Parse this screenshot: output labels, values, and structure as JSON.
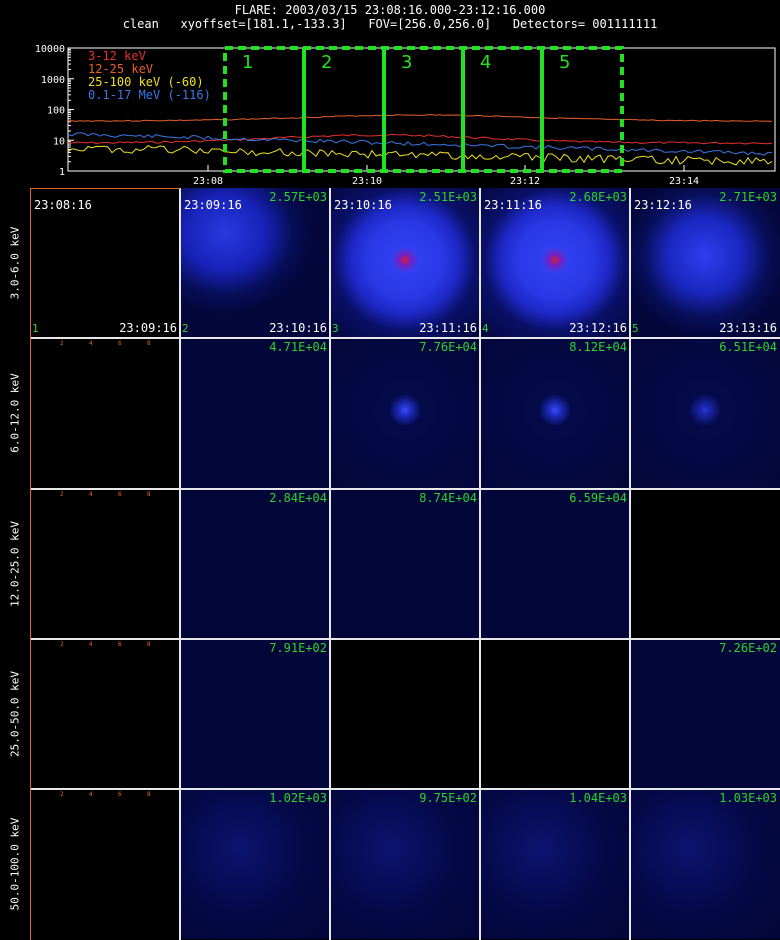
{
  "header": {
    "line1": "FLARE: 2003/03/15 23:08:16.000-23:12:16.000",
    "line2": "clean   xyoffset=[181.1,-133.3]   FOV=[256.0,256.0]   Detectors= 001111111"
  },
  "lightcurve": {
    "yticks": [
      "10000",
      "1000",
      "100",
      "10",
      "1"
    ],
    "xticks": [
      "23:08",
      "23:10",
      "23:12",
      "23:14"
    ],
    "legend": [
      {
        "label": "3-12 keV",
        "color": "#e8302c"
      },
      {
        "label": "12-25 keV",
        "color": "#e8602c"
      },
      {
        "label": "25-100 keV (-60)",
        "color": "#f0e020"
      },
      {
        "label": "0.1-17 MeV (-116)",
        "color": "#3a78e8"
      }
    ],
    "intervals": [
      "1",
      "2",
      "3",
      "4",
      "5"
    ],
    "interval_color": "#22e022"
  },
  "energy_bands": [
    "3.0-6.0 keV",
    "6.0-12.0 keV",
    "12.0-25.0 keV",
    "25.0-50.0 keV",
    "50.0-100.0 keV"
  ],
  "time_labels": {
    "starts": [
      "23:08:16",
      "23:09:16",
      "23:10:16",
      "23:11:16",
      "23:12:16"
    ],
    "ends": [
      "23:09:16",
      "23:10:16",
      "23:11:16",
      "23:12:16",
      "23:13:16"
    ],
    "numbers": [
      "1",
      "2",
      "3",
      "4",
      "5"
    ]
  },
  "small_ticks": [
    "2",
    "4",
    "6",
    "8"
  ],
  "maxima": [
    [
      "",
      "2.57E+03",
      "2.51E+03",
      "2.68E+03",
      "2.71E+03"
    ],
    [
      "",
      "4.71E+04",
      "7.76E+04",
      "8.12E+04",
      "6.51E+04"
    ],
    [
      "",
      "2.84E+04",
      "8.74E+04",
      "6.59E+04",
      ""
    ],
    [
      "",
      "7.91E+02",
      "",
      "",
      "7.26E+02"
    ],
    [
      "",
      "1.02E+03",
      "9.75E+02",
      "1.04E+03",
      "1.03E+03"
    ]
  ]
}
